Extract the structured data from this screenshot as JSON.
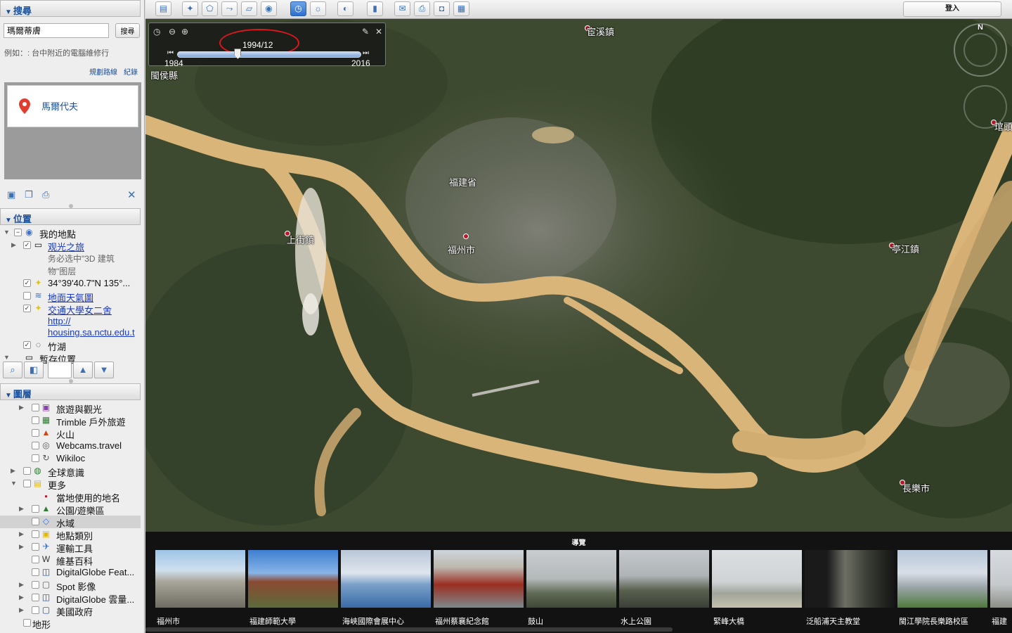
{
  "search": {
    "header": "搜尋",
    "value": "瑪爾蒂膚",
    "button": "搜尋",
    "hint": "例如：: 台中附近的電腦維修行",
    "link_route": "規劃路線",
    "link_history": "紀錄",
    "result": "馬爾代夫"
  },
  "places": {
    "header": "位置",
    "items": [
      {
        "label": "我的地點",
        "type": "text"
      },
      {
        "label": "观光之旅",
        "type": "link"
      },
      {
        "label": "务必选中\"3D 建筑",
        "type": "sub"
      },
      {
        "label": "物\"图层",
        "type": "sub"
      },
      {
        "label": "34°39'40.7\"N 135°...",
        "type": "text"
      },
      {
        "label": "地面天氣圖",
        "type": "link"
      },
      {
        "label": "交通大學女二舍",
        "type": "link"
      },
      {
        "label": "http://",
        "type": "link"
      },
      {
        "label": "housing.sa.nctu.edu.t",
        "type": "link"
      },
      {
        "label": "竹湖",
        "type": "text"
      },
      {
        "label": "暫存位置",
        "type": "text"
      }
    ]
  },
  "layers": {
    "header": "圖層",
    "items": [
      "旅遊與觀光",
      "Trimble 戶外旅遊",
      "火山",
      "Webcams.travel",
      "Wikiloc",
      "全球意識",
      "更多",
      "當地使用的地名",
      "公園/遊樂區",
      "水域",
      "地點類別",
      "運輸工具",
      "維基百科",
      "DigitalGlobe Feat...",
      "Spot 影像",
      "DigitalGlobe 雲量...",
      "美國政府",
      "地形"
    ]
  },
  "toolbar": {
    "login": "登入"
  },
  "time_slider": {
    "current": "1994/12",
    "start": "1984",
    "end": "2016",
    "position_fraction": 0.33
  },
  "map": {
    "compass_n": "N",
    "places": {
      "huanxi": "宦溪鎮",
      "minhou": "閩侯縣",
      "fujian": "福建省",
      "shangjie": "上街鎮",
      "fuzhou": "福州市",
      "tingjiang": "亭江鎮",
      "changle": "長樂市",
      "langqi": "琯頭"
    }
  },
  "tour": {
    "title": "導覽",
    "items": [
      "福州市",
      "福建師範大學",
      "海峽國際會展中心",
      "福州蔡襄紀念館",
      "鼓山",
      "水上公園",
      "緊峰大橋",
      "泛船浦天主教堂",
      "閩江學院長樂路校區",
      "福建"
    ]
  },
  "colors": {
    "accent": "#1a4f9a",
    "highlight_ring": "#e0161b",
    "river": "#d9b57a",
    "land": "#3f4a30"
  }
}
